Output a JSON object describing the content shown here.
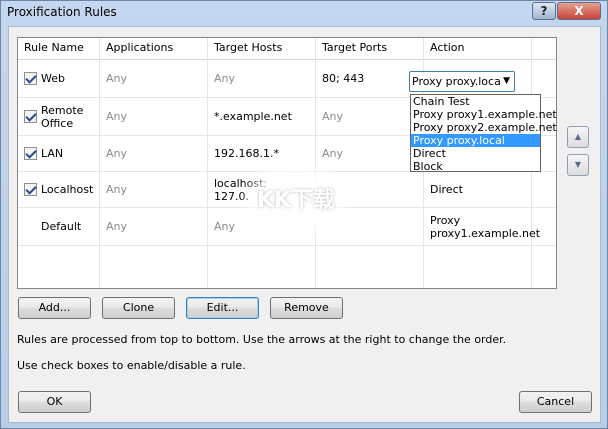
{
  "window": {
    "title": "Proxification Rules",
    "help": "?",
    "close": "X"
  },
  "columns": [
    "Rule Name",
    "Applications",
    "Target Hosts",
    "Target Ports",
    "Action"
  ],
  "rules": [
    {
      "checked": true,
      "name": "Web",
      "apps": "Any",
      "hosts": "Any",
      "ports": "80; 443",
      "action": ""
    },
    {
      "checked": true,
      "name": "Remote\nOffice",
      "apps": "Any",
      "hosts": "*.example.net",
      "ports": "Any",
      "action": ""
    },
    {
      "checked": true,
      "name": "LAN",
      "apps": "Any",
      "hosts": "192.168.1.*",
      "ports": "Any",
      "action": ""
    },
    {
      "checked": true,
      "name": "Localhost",
      "apps": "Any",
      "hosts": "localhost;\n127.0.",
      "ports": "",
      "action": "Direct"
    },
    {
      "checked": false,
      "name": "Default",
      "apps": "Any",
      "hosts": "Any",
      "ports": "",
      "action": "Proxy\nproxy1.example.net"
    }
  ],
  "combo": {
    "value": "Proxy proxy.loca",
    "arrow": "▼"
  },
  "dropdown": {
    "options": [
      "Chain Test",
      "Proxy proxy1.example.net",
      "Proxy proxy2.example.net",
      "Proxy proxy.local",
      "Direct",
      "Block"
    ],
    "selected_index": 3
  },
  "order": {
    "up": "▲",
    "down": "▼"
  },
  "buttons": {
    "add": "Add...",
    "clone": "Clone",
    "edit": "Edit...",
    "remove": "Remove",
    "ok": "OK",
    "cancel": "Cancel"
  },
  "info": {
    "line1": "Rules are processed from top to bottom. Use the arrows at the right to change the order.",
    "line2": "Use check boxes to enable/disable a rule."
  },
  "watermark": "KK下载"
}
